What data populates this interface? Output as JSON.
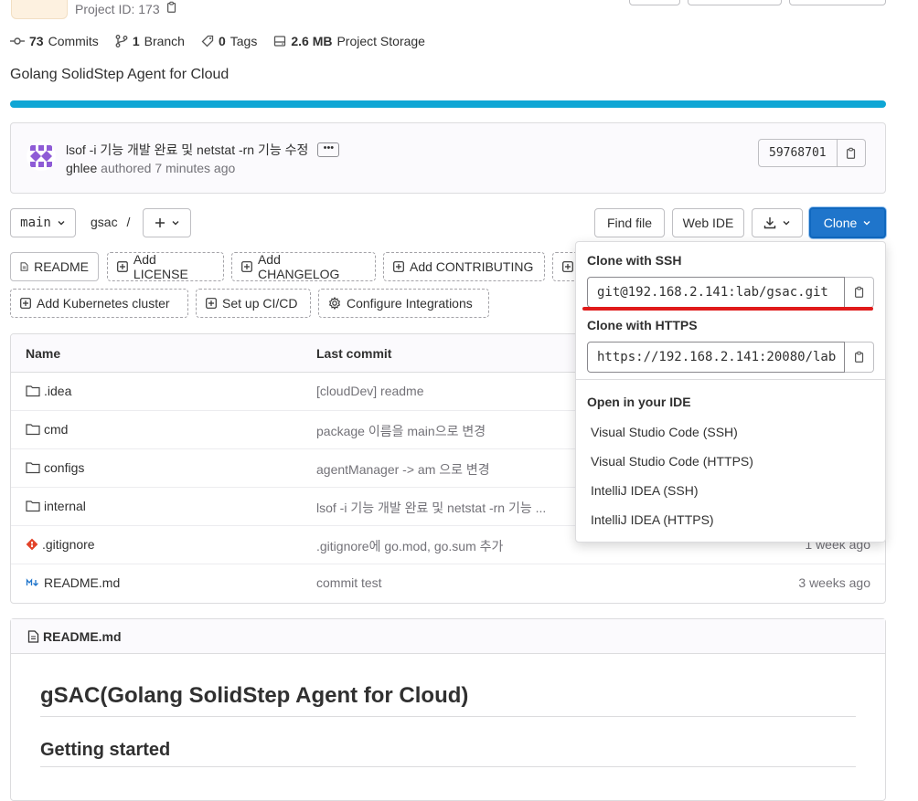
{
  "header": {
    "project_id": "Project ID: 173",
    "stats": [
      {
        "count": "73",
        "label": "Commits",
        "icon": "commit-icon"
      },
      {
        "count": "1",
        "label": "Branch",
        "icon": "branch-icon"
      },
      {
        "count": "0",
        "label": "Tags",
        "icon": "tag-icon"
      },
      {
        "count": "2.6 MB",
        "label": "Project Storage",
        "icon": "storage-icon"
      }
    ],
    "description": "Golang SolidStep Agent for Cloud"
  },
  "colors": {
    "accent": "#1f75cb",
    "progress": "#0fa6d5",
    "underline": "#e01a1a"
  },
  "commit": {
    "title": "lsof -i 기능 개발 완료 및 netstat -rn 기능 수정",
    "author": "ghlee",
    "authored": "authored",
    "time": "7 minutes ago",
    "sha": "59768701"
  },
  "toolbar": {
    "branch": "main",
    "path": "gsac",
    "separator": "/",
    "find_file": "Find file",
    "web_ide": "Web IDE",
    "clone": "Clone"
  },
  "quick_actions": {
    "readme": "README",
    "add_license": "Add LICENSE",
    "add_changelog": "Add CHANGELOG",
    "add_contributing": "Add CONTRIBUTING",
    "add_k8s": "Add Kubernetes cluster",
    "setup_cicd": "Set up CI/CD",
    "configure_integrations": "Configure Integrations"
  },
  "files": {
    "headers": {
      "name": "Name",
      "last_commit": "Last commit"
    },
    "rows": [
      {
        "name": ".idea",
        "type": "folder",
        "commit": "[cloudDev] readme",
        "date": ""
      },
      {
        "name": "cmd",
        "type": "folder",
        "commit": "package 이름을 main으로 변경",
        "date": ""
      },
      {
        "name": "configs",
        "type": "folder",
        "commit": "agentManager -> am 으로 변경",
        "date": ""
      },
      {
        "name": "internal",
        "type": "folder",
        "commit": "lsof -i 기능 개발 완료 및 netstat -rn 기능 ...",
        "date": ""
      },
      {
        "name": ".gitignore",
        "type": "git",
        "commit": ".gitignore에 go.mod, go.sum 추가",
        "date": "1 week ago"
      },
      {
        "name": "README.md",
        "type": "markdown",
        "commit": "commit test",
        "date": "3 weeks ago"
      }
    ]
  },
  "readme": {
    "filename": "README.md",
    "h1": "gSAC(Golang SolidStep Agent for Cloud)",
    "h2": "Getting started"
  },
  "clone_dropdown": {
    "ssh_label": "Clone with SSH",
    "ssh_url": "git@192.168.2.141:lab/gsac.git",
    "https_label": "Clone with HTTPS",
    "https_url": "https://192.168.2.141:20080/lab",
    "ide_label": "Open in your IDE",
    "ide_items": [
      "Visual Studio Code (SSH)",
      "Visual Studio Code (HTTPS)",
      "IntelliJ IDEA (SSH)",
      "IntelliJ IDEA (HTTPS)"
    ]
  }
}
